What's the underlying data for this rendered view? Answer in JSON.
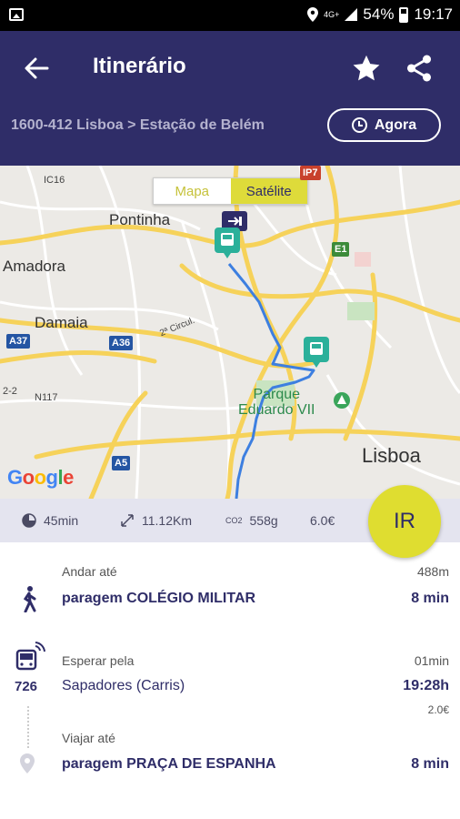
{
  "status_bar": {
    "network": "4G+",
    "battery": "54%",
    "time": "19:17",
    "icons": [
      "image-icon",
      "location-icon",
      "signal-icon",
      "battery-icon"
    ]
  },
  "header": {
    "title": "Itinerário",
    "route": "1600-412 Lisboa > Estação de Belém",
    "time_button": "Agora",
    "icons": [
      "back-arrow-icon",
      "star-icon",
      "share-icon",
      "clock-icon"
    ]
  },
  "map": {
    "toggle": {
      "map": "Mapa",
      "satellite": "Satélite",
      "selected": "Satélite"
    },
    "places": {
      "pontinha": "Pontinha",
      "amadora": "Amadora",
      "damaia": "Damaia",
      "park": "Parque\nEduardo VII",
      "lisboa": "Lisboa"
    },
    "roads": {
      "ic16": "IC16",
      "ip7": "IP7",
      "e1": "E1",
      "a37": "A37",
      "a36": "A36",
      "a5": "A5",
      "n117": "N117",
      "circ": "2ª Circul.",
      "r2": "2-2"
    },
    "logo": "Google",
    "colors": {
      "route": "#3d7fe0",
      "bus_marker": "#2bb09a",
      "accent": "#2f2d68"
    }
  },
  "stats": {
    "duration": "45min",
    "distance": "11.12Km",
    "co2_label": "CO2",
    "co2": "558g",
    "price": "6.0€",
    "go_button": "IR"
  },
  "steps": [
    {
      "label": "Andar até",
      "name": "paragem COLÉGIO MILITAR",
      "meta": "488m",
      "time": "8 min",
      "icon": "walking-icon"
    },
    {
      "label": "Esperar pela",
      "line": "726",
      "name": "Sapadores (Carris)",
      "meta": "01min",
      "time": "19:28h",
      "price": "2.0€",
      "icon": "bus-realtime-icon"
    },
    {
      "label": "Viajar até",
      "name": "paragem PRAÇA DE ESPANHA",
      "time": "8 min",
      "icon": "location-pin-icon"
    }
  ]
}
